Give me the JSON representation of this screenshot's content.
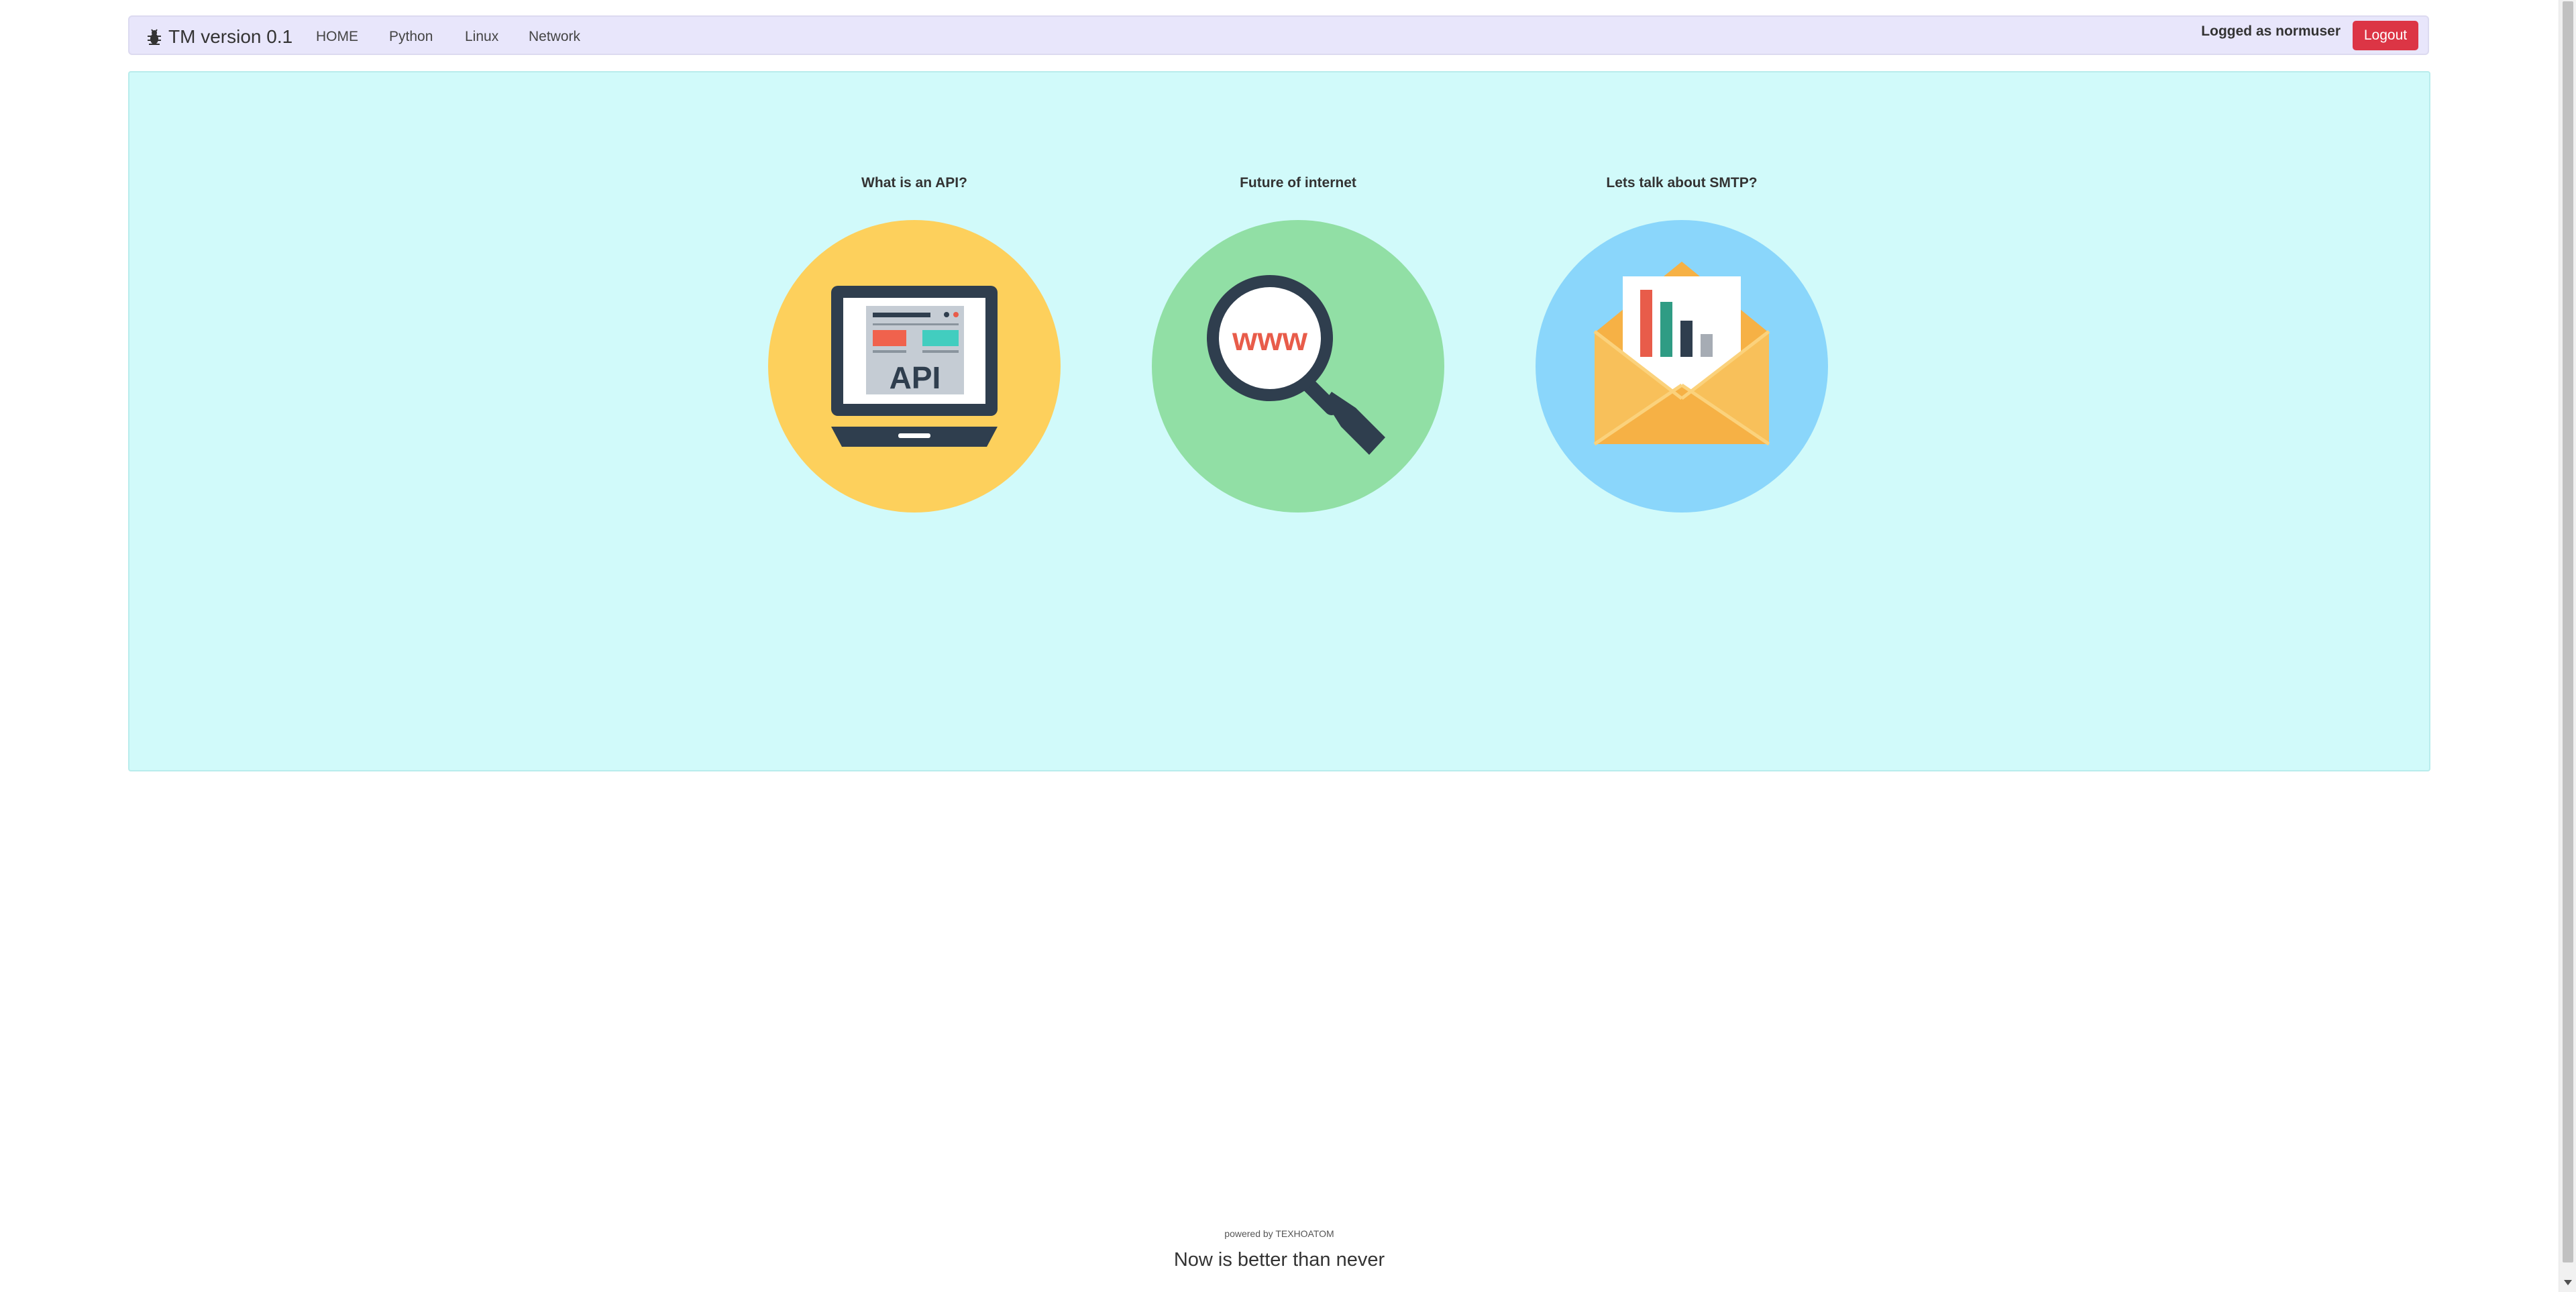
{
  "navbar": {
    "brand": "TM version 0.1",
    "brand_icon": "bug-icon",
    "links": [
      "HOME",
      "Python",
      "Linux",
      "Network"
    ],
    "logged_text": "Logged as normuser",
    "logout_label": "Logout",
    "colors": {
      "background": "#e8e6fb",
      "logout": "#dc3545"
    }
  },
  "main": {
    "background": "#d1fafa",
    "cards": [
      {
        "title": "What is an API?",
        "icon": "laptop-api-icon",
        "circle_color": "#fdd05c"
      },
      {
        "title": "Future of internet",
        "icon": "magnifier-www-icon",
        "circle_color": "#91dfa5"
      },
      {
        "title": "Lets talk about SMTP?",
        "icon": "envelope-chart-icon",
        "circle_color": "#8ad6fb"
      }
    ],
    "api_text": "API",
    "www_text": "www"
  },
  "footer": {
    "powered": "powered by TEXHOATOM",
    "motto": "Now is better than never"
  }
}
